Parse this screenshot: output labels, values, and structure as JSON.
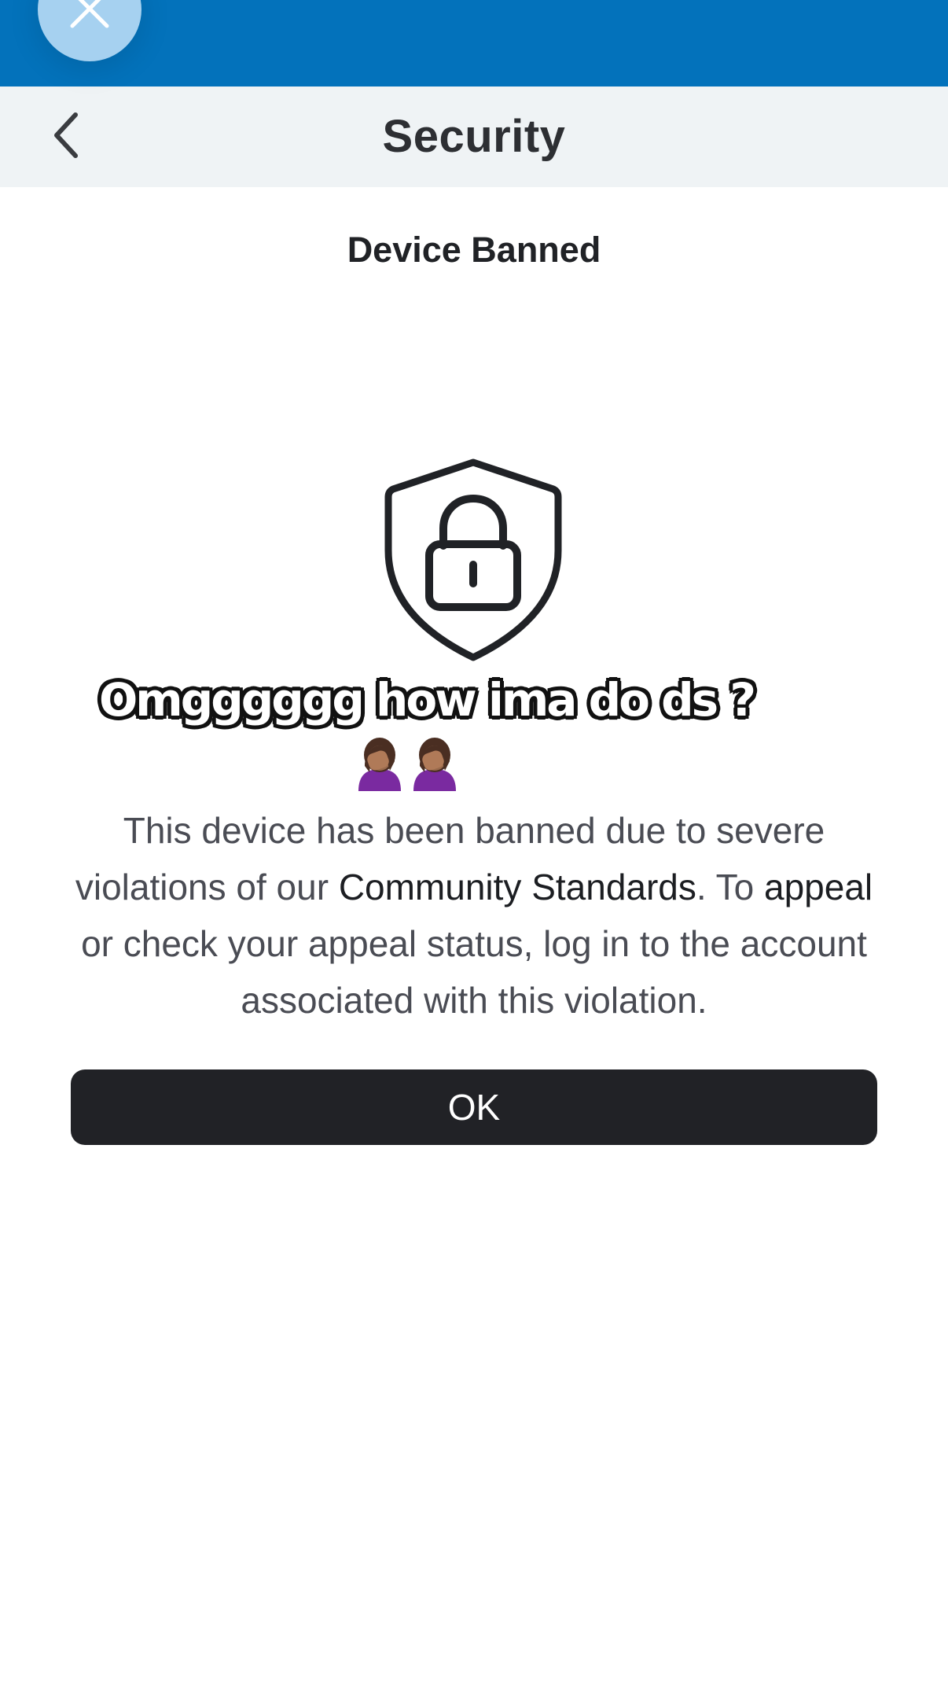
{
  "header": {
    "title": "Security",
    "back_icon": "chevron-left-icon",
    "close_icon": "close-icon"
  },
  "content": {
    "section_title": "Device Banned",
    "icon": "shield-lock-icon",
    "message": {
      "part1": "This device has been banned due to severe violations of our ",
      "link1": "Community Standards",
      "part2": ". To ",
      "link2": "appeal",
      "part3": " or check your appeal status, log in to the account associated with this violation."
    },
    "ok_label": "OK"
  },
  "overlay": {
    "caption": "Omgggggg how ima do ds ?",
    "emoji": "🤦🏾‍♀️🤦🏾‍♀️"
  },
  "colors": {
    "top_bar": "#0372bb",
    "header_bg": "#eff3f5",
    "button_bg": "#212226",
    "close_fab": "#a6d1f0"
  }
}
